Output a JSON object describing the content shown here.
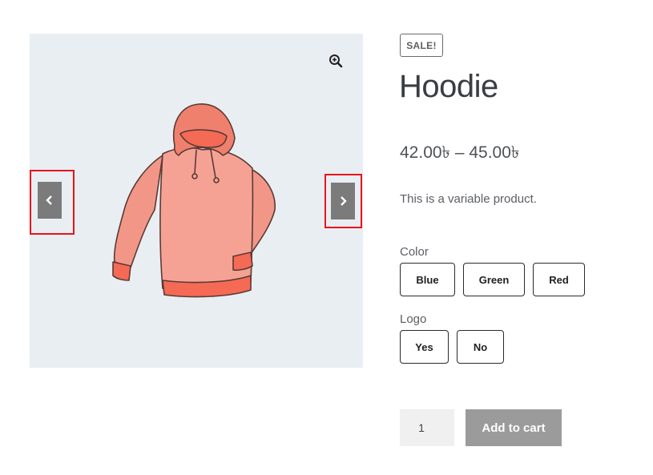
{
  "product": {
    "sale_badge": "SALE!",
    "title": "Hoodie",
    "price": "42.00৳ – 45.00৳",
    "description": "This is a variable product."
  },
  "gallery": {
    "zoom_icon": "zoom-in-icon",
    "prev_icon": "chevron-left-icon",
    "next_icon": "chevron-right-icon",
    "image": "hoodie-illustration"
  },
  "attributes": {
    "color": {
      "label": "Color",
      "options": [
        "Blue",
        "Green",
        "Red"
      ]
    },
    "logo": {
      "label": "Logo",
      "options": [
        "Yes",
        "No"
      ]
    }
  },
  "cart": {
    "quantity": "1",
    "add_to_cart_label": "Add to cart"
  },
  "colors": {
    "gallery_bg": "#e9eef2",
    "highlight": "#e8141b",
    "arrow_bg": "#7b7b7b",
    "button_bg": "#9b9b9b"
  }
}
